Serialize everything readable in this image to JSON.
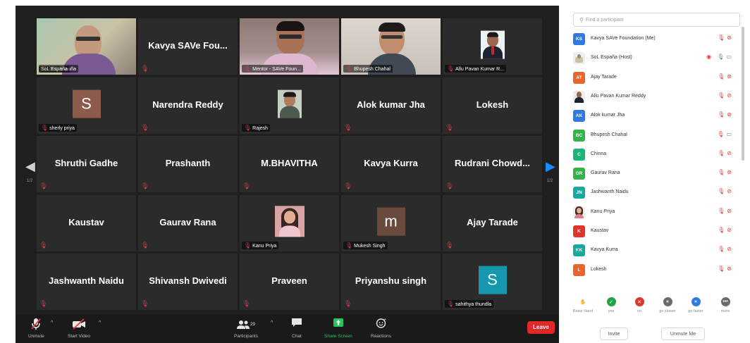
{
  "gallery": {
    "page_left": "1/2",
    "page_right": "1/2",
    "tiles": [
      {
        "type": "video",
        "label": "SoL España",
        "active": true,
        "scene": "host"
      },
      {
        "type": "name",
        "name": "Kavya SAVe Fou..."
      },
      {
        "type": "video",
        "label": "Mentor - SAVe Foun...",
        "scene": "mentor"
      },
      {
        "type": "video",
        "label": "Bhupesh Chahal",
        "scene": "bhupesh"
      },
      {
        "type": "photo",
        "label": "Allu Pavan Kumar R...",
        "scene": "allu"
      },
      {
        "type": "avatar",
        "initial": "S",
        "color": "#8d5b4c",
        "label": "sherly priya"
      },
      {
        "type": "name",
        "name": "Narendra Reddy"
      },
      {
        "type": "photo",
        "label": "Rajesh",
        "scene": "rajesh"
      },
      {
        "type": "name",
        "name": "Alok kumar Jha"
      },
      {
        "type": "name",
        "name": "Lokesh"
      },
      {
        "type": "name",
        "name": "Shruthi Gadhe"
      },
      {
        "type": "name",
        "name": "Prashanth"
      },
      {
        "type": "name",
        "name": "M.BHAVITHA"
      },
      {
        "type": "name",
        "name": "Kavya Kurra"
      },
      {
        "type": "name",
        "name": "Rudrani Chowd..."
      },
      {
        "type": "name",
        "name": "Kaustav"
      },
      {
        "type": "name",
        "name": "Gaurav Rana"
      },
      {
        "type": "photo",
        "label": "Kanu Priya",
        "scene": "kanu"
      },
      {
        "type": "avatar",
        "initial": "m",
        "color": "#6b4a3e",
        "label": "Mukesh Singh"
      },
      {
        "type": "name",
        "name": "Ajay Tarade"
      },
      {
        "type": "name",
        "name": "Jashwanth Naidu"
      },
      {
        "type": "name",
        "name": "Shivansh Dwivedi"
      },
      {
        "type": "name",
        "name": "Praveen"
      },
      {
        "type": "name",
        "name": "Priyanshu singh"
      },
      {
        "type": "avatar",
        "initial": "S",
        "color": "#1697b0",
        "label": "sahithya thundla"
      }
    ]
  },
  "toolbar": {
    "unmute": "Unmute",
    "start_video": "Start Video",
    "participants": "Participants",
    "participants_count": "29",
    "chat": "Chat",
    "share_screen": "Share Screen",
    "reactions": "Reactions",
    "leave": "Leave"
  },
  "panel": {
    "search_placeholder": "Find a participant",
    "participants": [
      {
        "initials": "KS",
        "color": "#2d7be0",
        "name": "Kavya SAVe Foundation (Me)",
        "icons": "mic-video"
      },
      {
        "initials": "",
        "color": "",
        "name": "SoL España (Host)",
        "icons": "host",
        "photo": "host"
      },
      {
        "initials": "AT",
        "color": "#e8652b",
        "name": "Ajay Tarade",
        "icons": "mic-video"
      },
      {
        "initials": "",
        "color": "",
        "name": "Allu Pavan Kumar Reddy",
        "icons": "mic-video",
        "photo": "allu"
      },
      {
        "initials": "AK",
        "color": "#2d7be0",
        "name": "Alok kumar Jha",
        "icons": "mic-video"
      },
      {
        "initials": "BC",
        "color": "#34b34a",
        "name": "Bhupesh Chahal",
        "icons": "mic-video-on"
      },
      {
        "initials": "C",
        "color": "#19b57a",
        "name": "Chinna",
        "icons": "mic-video"
      },
      {
        "initials": "GR",
        "color": "#34b34a",
        "name": "Gaurav Rana",
        "icons": "mic-video"
      },
      {
        "initials": "JN",
        "color": "#17a8a0",
        "name": "Jashwanth Naidu",
        "icons": "mic-video"
      },
      {
        "initials": "",
        "color": "",
        "name": "Kanu Priya",
        "icons": "mic-video",
        "photo": "kanu"
      },
      {
        "initials": "K",
        "color": "#e0352b",
        "name": "Kaustav",
        "icons": "mic-video"
      },
      {
        "initials": "KK",
        "color": "#17a8a0",
        "name": "Kavya Kurra",
        "icons": "mic-video"
      },
      {
        "initials": "L",
        "color": "#e8652b",
        "name": "Lokesh",
        "icons": "mic-video"
      }
    ],
    "reactions": [
      {
        "label": "Raise Hand",
        "color": "#ffffff",
        "glyph": "✋",
        "glyph_color": "#2d7be0"
      },
      {
        "label": "yes",
        "color": "#22a348",
        "glyph": "✓",
        "glyph_color": "#ffffff"
      },
      {
        "label": "no",
        "color": "#e0352b",
        "glyph": "✕",
        "glyph_color": "#ffffff"
      },
      {
        "label": "go slower",
        "color": "#6b6b6b",
        "glyph": "«",
        "glyph_color": "#ffffff"
      },
      {
        "label": "go faster",
        "color": "#2d7be0",
        "glyph": "»",
        "glyph_color": "#ffffff"
      },
      {
        "label": "more",
        "color": "#6b6b6b",
        "glyph": "•••",
        "glyph_color": "#ffffff"
      }
    ],
    "invite": "Invite",
    "unmute_me": "Unmute Me"
  }
}
